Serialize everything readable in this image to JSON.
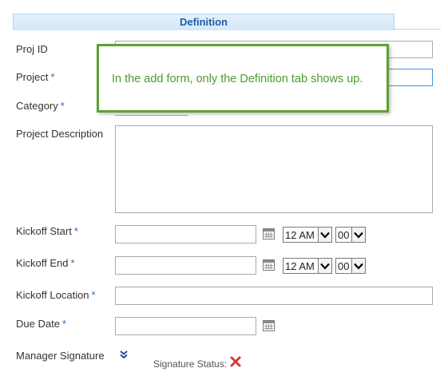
{
  "tab": {
    "label": "Definition"
  },
  "callout": {
    "text": "In the add form, only the Definition tab shows up."
  },
  "fields": {
    "proj_id": {
      "label": "Proj ID",
      "value": ""
    },
    "project": {
      "label": "Project",
      "required": "*",
      "value": ""
    },
    "category": {
      "label": "Category",
      "required": "*"
    },
    "description": {
      "label": "Project Description",
      "value": ""
    },
    "kickoff_start": {
      "label": "Kickoff Start",
      "required": "*",
      "value": "",
      "hour": "12 AM",
      "minute": "00"
    },
    "kickoff_end": {
      "label": "Kickoff End",
      "required": "*",
      "value": "",
      "hour": "12 AM",
      "minute": "00"
    },
    "kickoff_location": {
      "label": "Kickoff Location",
      "required": "*",
      "value": ""
    },
    "due_date": {
      "label": "Due Date",
      "required": "*",
      "value": ""
    },
    "manager_signature": {
      "label": "Manager Signature",
      "status_label": "Signature Status:"
    }
  },
  "icons": {
    "calendar": "calendar-icon",
    "expand": "double-chevron-down-icon",
    "status": "red-x-icon"
  },
  "colors": {
    "tab_text": "#1f5fa6",
    "required": "#2a6db8",
    "callout_border": "#5fa033",
    "callout_text": "#4e9a2a",
    "status_x": "#d9363e"
  }
}
